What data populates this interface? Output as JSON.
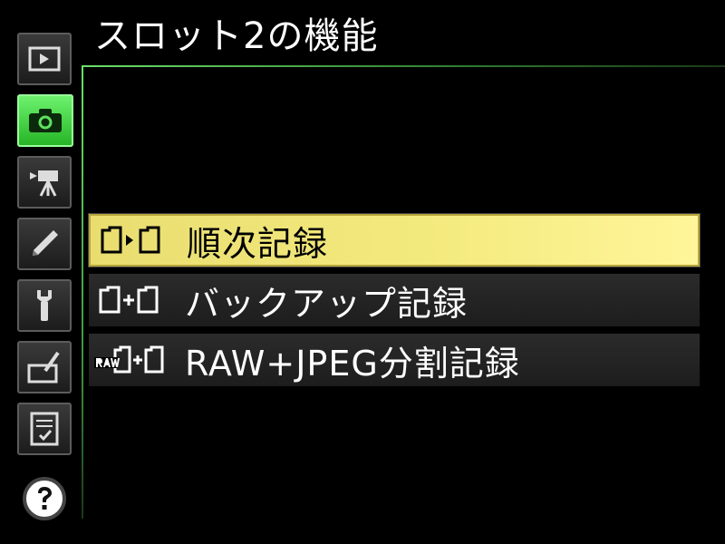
{
  "title": "スロット2の機能",
  "sidebar": {
    "tabs": [
      {
        "name": "playback-menu-tab",
        "icon": "playback-icon",
        "active": false
      },
      {
        "name": "photo-shooting-menu-tab",
        "icon": "camera-icon",
        "active": true
      },
      {
        "name": "movie-shooting-menu-tab",
        "icon": "movie-camera-icon",
        "active": false
      },
      {
        "name": "custom-settings-menu-tab",
        "icon": "pencil-icon",
        "active": false
      },
      {
        "name": "setup-menu-tab",
        "icon": "wrench-icon",
        "active": false
      },
      {
        "name": "retouch-menu-tab",
        "icon": "retouch-brush-icon",
        "active": false
      },
      {
        "name": "my-menu-tab",
        "icon": "my-menu-list-icon",
        "active": false
      },
      {
        "name": "help-button",
        "icon": "help-icon",
        "active": false
      }
    ],
    "active_color": "#3cd63c"
  },
  "menu": {
    "items": [
      {
        "label": "順次記録",
        "icon": "card-overflow-icon",
        "selected": true
      },
      {
        "label": "バックアップ記録",
        "icon": "card-backup-icon",
        "selected": false
      },
      {
        "label": "RAW+JPEG分割記録",
        "icon": "raw-jpeg-separate-icon",
        "selected": false
      }
    ],
    "selected_color": "#f0e77a"
  }
}
